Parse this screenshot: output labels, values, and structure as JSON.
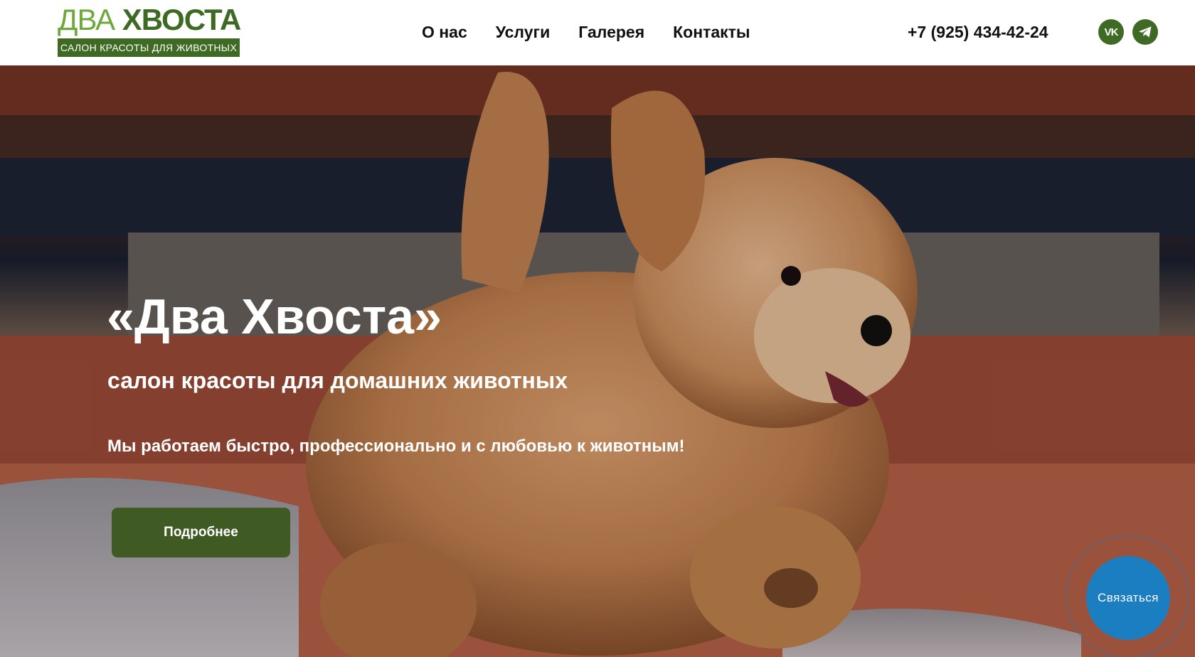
{
  "header": {
    "logo": {
      "title_part1": "ДВА",
      "title_part2": "ХВОСТА",
      "subtitle": "САЛОН КРАСОТЫ ДЛЯ ЖИВОТНЫХ"
    },
    "nav": [
      "О нас",
      "Услуги",
      "Галерея",
      "Контакты"
    ],
    "phone": "+7 (925) 434-42-24",
    "social": [
      {
        "icon": "vk-icon",
        "label": "VK"
      },
      {
        "icon": "telegram-icon"
      }
    ]
  },
  "hero": {
    "title": "«Два Хвоста»",
    "subtitle": "салон красоты для домашних животных",
    "text": "Мы работаем быстро, профессионально и с любовью к животным!",
    "button_label": "Подробнее",
    "image": "dog-photo"
  },
  "contact_widget": {
    "label": "Связаться"
  },
  "colors": {
    "brand_green": "#3f6a24",
    "logo_light_green": "#6fa83a",
    "button_green": "#3f5a23",
    "contact_blue": "#1b7ec1"
  }
}
